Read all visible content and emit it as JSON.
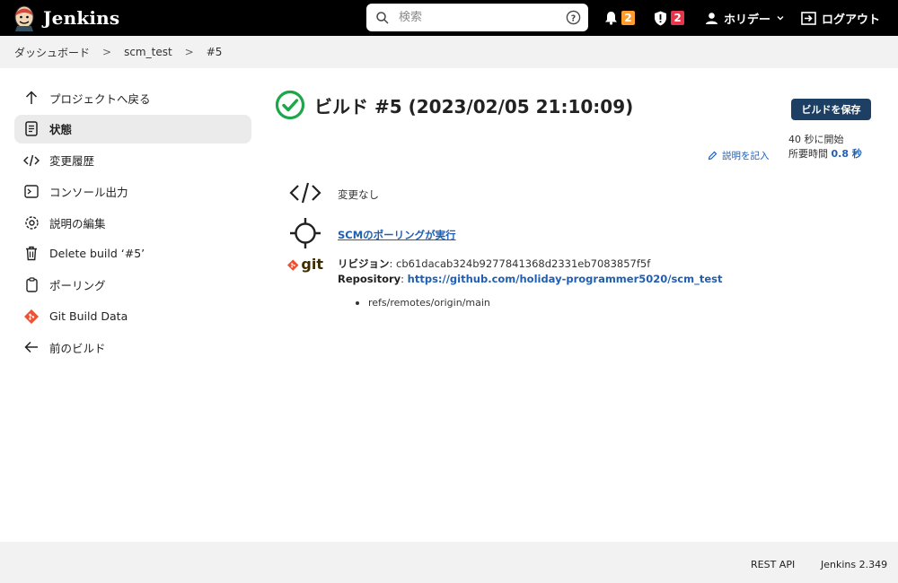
{
  "header": {
    "logo_text": "Jenkins",
    "search_placeholder": "検索",
    "notifications_count": "2",
    "security_count": "2",
    "user_name": "ホリデー",
    "logout_label": "ログアウト",
    "colors": {
      "bg": "#000000",
      "notif_badge": "#fe9c2e",
      "security_badge": "#e6364b"
    }
  },
  "breadcrumb": {
    "items": [
      "ダッシュボード",
      "scm_test",
      "#5"
    ]
  },
  "sidebar": {
    "items": [
      {
        "label": "プロジェクトへ戻る",
        "icon": "arrow-up-icon"
      },
      {
        "label": "状態",
        "icon": "document-icon",
        "active": true
      },
      {
        "label": "変更履歴",
        "icon": "code-icon"
      },
      {
        "label": "コンソール出力",
        "icon": "terminal-icon"
      },
      {
        "label": "説明の編集",
        "icon": "gear-icon"
      },
      {
        "label": "Delete build ‘#5’",
        "icon": "trash-icon"
      },
      {
        "label": "ポーリング",
        "icon": "clipboard-icon"
      },
      {
        "label": "Git Build Data",
        "icon": "git-logo-icon"
      },
      {
        "label": "前のビルド",
        "icon": "arrow-left-icon"
      }
    ]
  },
  "main": {
    "title": "ビルド #5 (2023/02/05 21:10:09)",
    "save_button": "ビルドを保存",
    "started": "40 秒に開始",
    "duration_label": "所要時間",
    "duration_value": "0.8 秒",
    "add_description": "説明を記入",
    "changes_text": "変更なし",
    "polling_link": "SCMのポーリングが実行",
    "git_label": "git",
    "revision_label": "リビジョン",
    "revision_value": "cb61dacab324b9277841368d2331eb7083857f5f",
    "repository_label": "Repository",
    "repository_url": "https://github.com/holiday-programmer5020/scm_test",
    "refs": [
      "refs/remotes/origin/main"
    ],
    "status_color": "#1ea64b"
  },
  "footer": {
    "rest_api": "REST API",
    "version": "Jenkins 2.349"
  }
}
